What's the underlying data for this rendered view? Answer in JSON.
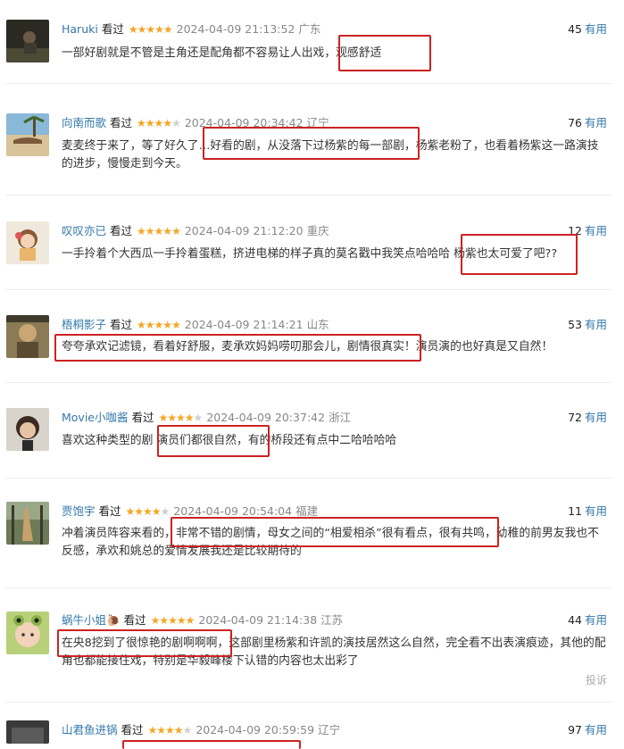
{
  "reviews": [
    {
      "user": "Haruki",
      "watched": "看过",
      "stars": "★★★★★",
      "stars_off": "",
      "time": "2024-04-09 21:13:52",
      "location": "广东",
      "votes": "45",
      "useful": "有用",
      "text": "一部好剧就是不管是主角还是配角都不容易让人出戏，观感舒适"
    },
    {
      "user": "向南而歌",
      "watched": "看过",
      "stars": "★★★★",
      "stars_off": "★",
      "time": "2024-04-09 20:34:42",
      "location": "辽宁",
      "votes": "76",
      "useful": "有用",
      "text": "麦麦终于来了，等了好久了…好看的剧，从没落下过杨紫的每一部剧，杨紫老粉了，也看着杨紫这一路演技的进步，慢慢走到今天。"
    },
    {
      "user": "叹叹亦已",
      "watched": "看过",
      "stars": "★★★★★",
      "stars_off": "",
      "time": "2024-04-09 21:12:20",
      "location": "重庆",
      "votes": "12",
      "useful": "有用",
      "text": "一手拎着个大西瓜一手拎着蛋糕，挤进电梯的样子真的莫名戳中我笑点哈哈哈 杨紫也太可爱了吧??"
    },
    {
      "user": "梧桐影子",
      "watched": "看过",
      "stars": "★★★★★",
      "stars_off": "",
      "time": "2024-04-09 21:14:21",
      "location": "山东",
      "votes": "53",
      "useful": "有用",
      "text": "夸夸承欢记滤镜，看着好舒服，麦承欢妈妈唠叨那会儿，剧情很真实！演员演的也好真是又自然！"
    },
    {
      "user": "Movie小咖酱",
      "watched": "看过",
      "stars": "★★★★",
      "stars_off": "★",
      "time": "2024-04-09 20:37:42",
      "location": "浙江",
      "votes": "72",
      "useful": "有用",
      "text": "喜欢这种类型的剧  演员们都很自然，有的桥段还有点中二哈哈哈哈"
    },
    {
      "user": "贾饱宇",
      "watched": "看过",
      "stars": "★★★★",
      "stars_off": "★",
      "time": "2024-04-09 20:54:04",
      "location": "福建",
      "votes": "11",
      "useful": "有用",
      "text": "冲着演员阵容来看的，非常不错的剧情，母女之间的“相爱相杀”很有看点，很有共鸣，幼稚的前男友我也不反感，承欢和姚总的爱情发展我还是比较期待的"
    },
    {
      "user": "蜗牛小姐🐌",
      "watched": "看过",
      "stars": "★★★★★",
      "stars_off": "",
      "time": "2024-04-09 21:14:38",
      "location": "江苏",
      "votes": "44",
      "useful": "有用",
      "text": "在央8挖到了很惊艳的剧啊啊啊，这部剧里杨紫和许凯的演技居然这么自然，完全看不出表演痕迹，其他的配角也都能接住戏，特别是华毅峰楼下认错的内容也太出彩了"
    },
    {
      "user": "山君鱼进锅",
      "watched": "看过",
      "stars": "★★★★",
      "stars_off": "★",
      "time": "2024-04-09 20:59:59",
      "location": "辽宁",
      "votes": "97",
      "useful": "有用",
      "text": ""
    }
  ],
  "report_label": "投诉",
  "colors": {
    "username": "#3377aa",
    "star": "#f5a623",
    "highlight": "#cc2222"
  }
}
